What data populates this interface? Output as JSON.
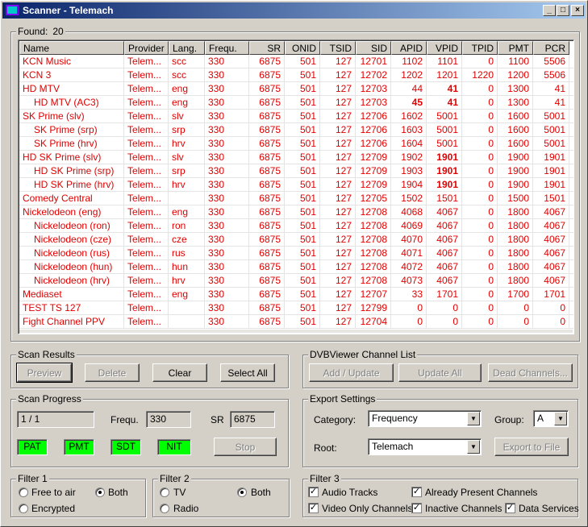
{
  "window": {
    "title": "Scanner - Telemach",
    "minimize": "_",
    "maximize": "□",
    "close": "×"
  },
  "found": {
    "label": "Found:",
    "count": "20"
  },
  "columns": [
    {
      "key": "name",
      "label": "Name",
      "w": 130,
      "num": false
    },
    {
      "key": "provider",
      "label": "Provider",
      "w": 55,
      "num": false
    },
    {
      "key": "lang",
      "label": "Lang.",
      "w": 45,
      "num": false
    },
    {
      "key": "frequ",
      "label": "Frequ.",
      "w": 55,
      "num": false
    },
    {
      "key": "sr",
      "label": "SR",
      "w": 44,
      "num": true
    },
    {
      "key": "onid",
      "label": "ONID",
      "w": 44,
      "num": true
    },
    {
      "key": "tsid",
      "label": "TSID",
      "w": 44,
      "num": true
    },
    {
      "key": "sid",
      "label": "SID",
      "w": 44,
      "num": true
    },
    {
      "key": "apid",
      "label": "APID",
      "w": 44,
      "num": true
    },
    {
      "key": "vpid",
      "label": "VPID",
      "w": 44,
      "num": true
    },
    {
      "key": "tpid",
      "label": "TPID",
      "w": 44,
      "num": true
    },
    {
      "key": "pmt",
      "label": "PMT",
      "w": 44,
      "num": true
    },
    {
      "key": "pcr",
      "label": "PCR",
      "w": 45,
      "num": true
    }
  ],
  "rows": [
    {
      "name": "KCN Music",
      "indent": false,
      "provider": "Telem...",
      "lang": "scc",
      "frequ": "330",
      "sr": "6875",
      "onid": "501",
      "tsid": "127",
      "sid": "12701",
      "apid": "1102",
      "vpid": "1101",
      "tpid": "0",
      "pmt": "1100",
      "pcr": "5506",
      "bold": []
    },
    {
      "name": "KCN 3",
      "indent": false,
      "provider": "Telem...",
      "lang": "scc",
      "frequ": "330",
      "sr": "6875",
      "onid": "501",
      "tsid": "127",
      "sid": "12702",
      "apid": "1202",
      "vpid": "1201",
      "tpid": "1220",
      "pmt": "1200",
      "pcr": "5506",
      "bold": []
    },
    {
      "name": "HD MTV",
      "indent": false,
      "provider": "Telem...",
      "lang": "eng",
      "frequ": "330",
      "sr": "6875",
      "onid": "501",
      "tsid": "127",
      "sid": "12703",
      "apid": "44",
      "vpid": "41",
      "tpid": "0",
      "pmt": "1300",
      "pcr": "41",
      "bold": [
        "vpid"
      ]
    },
    {
      "name": "HD MTV (AC3)",
      "indent": true,
      "provider": "Telem...",
      "lang": "eng",
      "frequ": "330",
      "sr": "6875",
      "onid": "501",
      "tsid": "127",
      "sid": "12703",
      "apid": "45",
      "vpid": "41",
      "tpid": "0",
      "pmt": "1300",
      "pcr": "41",
      "bold": [
        "apid",
        "vpid"
      ]
    },
    {
      "name": "SK Prime (slv)",
      "indent": false,
      "provider": "Telem...",
      "lang": "slv",
      "frequ": "330",
      "sr": "6875",
      "onid": "501",
      "tsid": "127",
      "sid": "12706",
      "apid": "1602",
      "vpid": "5001",
      "tpid": "0",
      "pmt": "1600",
      "pcr": "5001",
      "bold": []
    },
    {
      "name": "SK Prime (srp)",
      "indent": true,
      "provider": "Telem...",
      "lang": "srp",
      "frequ": "330",
      "sr": "6875",
      "onid": "501",
      "tsid": "127",
      "sid": "12706",
      "apid": "1603",
      "vpid": "5001",
      "tpid": "0",
      "pmt": "1600",
      "pcr": "5001",
      "bold": []
    },
    {
      "name": "SK Prime (hrv)",
      "indent": true,
      "provider": "Telem...",
      "lang": "hrv",
      "frequ": "330",
      "sr": "6875",
      "onid": "501",
      "tsid": "127",
      "sid": "12706",
      "apid": "1604",
      "vpid": "5001",
      "tpid": "0",
      "pmt": "1600",
      "pcr": "5001",
      "bold": []
    },
    {
      "name": "HD SK Prime (slv)",
      "indent": false,
      "provider": "Telem...",
      "lang": "slv",
      "frequ": "330",
      "sr": "6875",
      "onid": "501",
      "tsid": "127",
      "sid": "12709",
      "apid": "1902",
      "vpid": "1901",
      "tpid": "0",
      "pmt": "1900",
      "pcr": "1901",
      "bold": [
        "vpid"
      ]
    },
    {
      "name": "HD SK Prime (srp)",
      "indent": true,
      "provider": "Telem...",
      "lang": "srp",
      "frequ": "330",
      "sr": "6875",
      "onid": "501",
      "tsid": "127",
      "sid": "12709",
      "apid": "1903",
      "vpid": "1901",
      "tpid": "0",
      "pmt": "1900",
      "pcr": "1901",
      "bold": [
        "vpid"
      ]
    },
    {
      "name": "HD SK Prime (hrv)",
      "indent": true,
      "provider": "Telem...",
      "lang": "hrv",
      "frequ": "330",
      "sr": "6875",
      "onid": "501",
      "tsid": "127",
      "sid": "12709",
      "apid": "1904",
      "vpid": "1901",
      "tpid": "0",
      "pmt": "1900",
      "pcr": "1901",
      "bold": [
        "vpid"
      ]
    },
    {
      "name": "Comedy Central",
      "indent": false,
      "provider": "Telem...",
      "lang": "",
      "frequ": "330",
      "sr": "6875",
      "onid": "501",
      "tsid": "127",
      "sid": "12705",
      "apid": "1502",
      "vpid": "1501",
      "tpid": "0",
      "pmt": "1500",
      "pcr": "1501",
      "bold": []
    },
    {
      "name": "Nickelodeon (eng)",
      "indent": false,
      "provider": "Telem...",
      "lang": "eng",
      "frequ": "330",
      "sr": "6875",
      "onid": "501",
      "tsid": "127",
      "sid": "12708",
      "apid": "4068",
      "vpid": "4067",
      "tpid": "0",
      "pmt": "1800",
      "pcr": "4067",
      "bold": []
    },
    {
      "name": "Nickelodeon (ron)",
      "indent": true,
      "provider": "Telem...",
      "lang": "ron",
      "frequ": "330",
      "sr": "6875",
      "onid": "501",
      "tsid": "127",
      "sid": "12708",
      "apid": "4069",
      "vpid": "4067",
      "tpid": "0",
      "pmt": "1800",
      "pcr": "4067",
      "bold": []
    },
    {
      "name": "Nickelodeon (cze)",
      "indent": true,
      "provider": "Telem...",
      "lang": "cze",
      "frequ": "330",
      "sr": "6875",
      "onid": "501",
      "tsid": "127",
      "sid": "12708",
      "apid": "4070",
      "vpid": "4067",
      "tpid": "0",
      "pmt": "1800",
      "pcr": "4067",
      "bold": []
    },
    {
      "name": "Nickelodeon (rus)",
      "indent": true,
      "provider": "Telem...",
      "lang": "rus",
      "frequ": "330",
      "sr": "6875",
      "onid": "501",
      "tsid": "127",
      "sid": "12708",
      "apid": "4071",
      "vpid": "4067",
      "tpid": "0",
      "pmt": "1800",
      "pcr": "4067",
      "bold": []
    },
    {
      "name": "Nickelodeon (hun)",
      "indent": true,
      "provider": "Telem...",
      "lang": "hun",
      "frequ": "330",
      "sr": "6875",
      "onid": "501",
      "tsid": "127",
      "sid": "12708",
      "apid": "4072",
      "vpid": "4067",
      "tpid": "0",
      "pmt": "1800",
      "pcr": "4067",
      "bold": []
    },
    {
      "name": "Nickelodeon (hrv)",
      "indent": true,
      "provider": "Telem...",
      "lang": "hrv",
      "frequ": "330",
      "sr": "6875",
      "onid": "501",
      "tsid": "127",
      "sid": "12708",
      "apid": "4073",
      "vpid": "4067",
      "tpid": "0",
      "pmt": "1800",
      "pcr": "4067",
      "bold": []
    },
    {
      "name": "Mediaset",
      "indent": false,
      "provider": "Telem...",
      "lang": "eng",
      "frequ": "330",
      "sr": "6875",
      "onid": "501",
      "tsid": "127",
      "sid": "12707",
      "apid": "33",
      "vpid": "1701",
      "tpid": "0",
      "pmt": "1700",
      "pcr": "1701",
      "bold": []
    },
    {
      "name": "TEST TS 127",
      "indent": false,
      "provider": "Telem...",
      "lang": "",
      "frequ": "330",
      "sr": "6875",
      "onid": "501",
      "tsid": "127",
      "sid": "12799",
      "apid": "0",
      "vpid": "0",
      "tpid": "0",
      "pmt": "0",
      "pcr": "0",
      "bold": []
    },
    {
      "name": "Fight Channel PPV",
      "indent": false,
      "provider": "Telem...",
      "lang": "",
      "frequ": "330",
      "sr": "6875",
      "onid": "501",
      "tsid": "127",
      "sid": "12704",
      "apid": "0",
      "vpid": "0",
      "tpid": "0",
      "pmt": "0",
      "pcr": "0",
      "bold": []
    }
  ],
  "scan_results": {
    "title": "Scan Results",
    "preview": "Preview",
    "delete": "Delete",
    "clear": "Clear",
    "select_all": "Select All"
  },
  "channel_list": {
    "title": "DVBViewer Channel List",
    "add_update": "Add / Update",
    "update_all": "Update All",
    "dead_channels": "Dead Channels..."
  },
  "scan_progress": {
    "title": "Scan Progress",
    "progress": "1 / 1",
    "frequ_label": "Frequ.",
    "frequ_value": "330",
    "sr_label": "SR",
    "sr_value": "6875",
    "indicators": [
      "PAT",
      "PMT",
      "SDT",
      "NIT"
    ],
    "indicator_color": "#00ff00",
    "stop": "Stop"
  },
  "export": {
    "title": "Export Settings",
    "category_label": "Category:",
    "category_value": "Frequency",
    "group_label": "Group:",
    "group_value": "A",
    "root_label": "Root:",
    "root_value": "Telemach",
    "export_button": "Export to File"
  },
  "filter1": {
    "title": "Filter 1",
    "free": "Free to air",
    "encrypted": "Encrypted",
    "both": "Both"
  },
  "filter2": {
    "title": "Filter 2",
    "tv": "TV",
    "radio": "Radio",
    "both": "Both"
  },
  "filter3": {
    "title": "Filter 3",
    "audio": "Audio Tracks",
    "present": "Already Present Channels",
    "video": "Video Only Channels",
    "inactive": "Inactive Channels",
    "data": "Data Services"
  },
  "colors": {
    "row_text": "#e00000",
    "titlebar_start": "#0a246a",
    "titlebar_end": "#a6caf0"
  }
}
